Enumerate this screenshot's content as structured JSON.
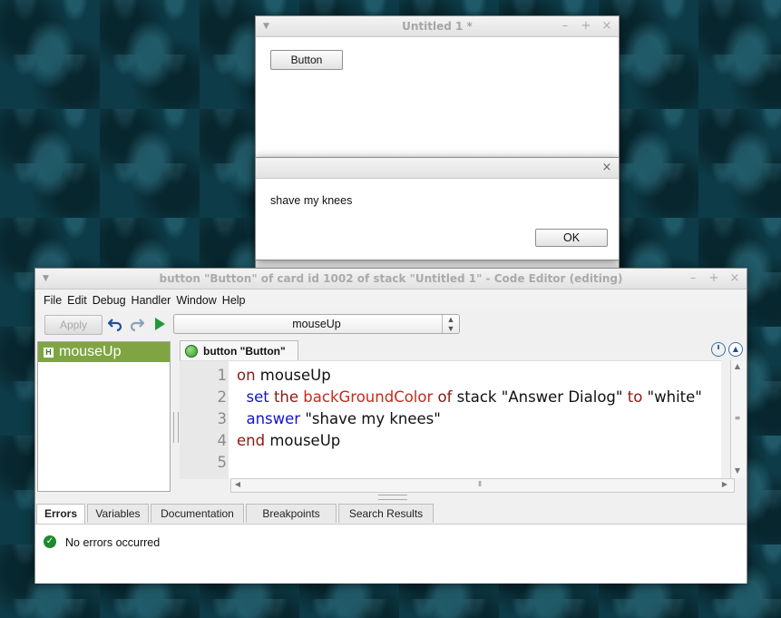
{
  "stack_window": {
    "title": "Untitled 1 *",
    "button_label": "Button"
  },
  "dialog": {
    "message": "shave my knees",
    "ok_label": "OK"
  },
  "editor": {
    "title": "button \"Button\" of card id 1002 of stack \"Untitled 1\" - Code Editor (editing)",
    "menu": [
      "File",
      "Edit",
      "Debug",
      "Handler",
      "Window",
      "Help"
    ],
    "apply_label": "Apply",
    "handler_select": "mouseUp",
    "handlers": [
      "mouseUp"
    ],
    "handler_badge": "H",
    "object_tab": "button \"Button\"",
    "code_lines": [
      {
        "num": "1",
        "tokens": [
          {
            "t": "on",
            "c": "kw"
          },
          {
            "t": " mouseUp",
            "c": ""
          }
        ]
      },
      {
        "num": "2",
        "tokens": [
          {
            "t": "  set",
            "c": "cmd"
          },
          {
            "t": " the",
            "c": "kw"
          },
          {
            "t": " backGroundColor",
            "c": "prop"
          },
          {
            "t": " of",
            "c": "kw"
          },
          {
            "t": " stack \"Answer Dialog\" ",
            "c": ""
          },
          {
            "t": "to",
            "c": "kw"
          },
          {
            "t": " \"white\"",
            "c": ""
          }
        ]
      },
      {
        "num": "3",
        "tokens": [
          {
            "t": "  answer",
            "c": "cmd"
          },
          {
            "t": " \"shave my knees\"",
            "c": ""
          }
        ]
      },
      {
        "num": "4",
        "tokens": [
          {
            "t": "end",
            "c": "kw"
          },
          {
            "t": " mouseUp",
            "c": ""
          }
        ]
      },
      {
        "num": "5",
        "tokens": []
      }
    ],
    "bottom_tabs": [
      "Errors",
      "Variables",
      "Documentation",
      "Breakpoints",
      "Search Results"
    ],
    "active_tab": "Errors",
    "status": "No errors occurred"
  }
}
